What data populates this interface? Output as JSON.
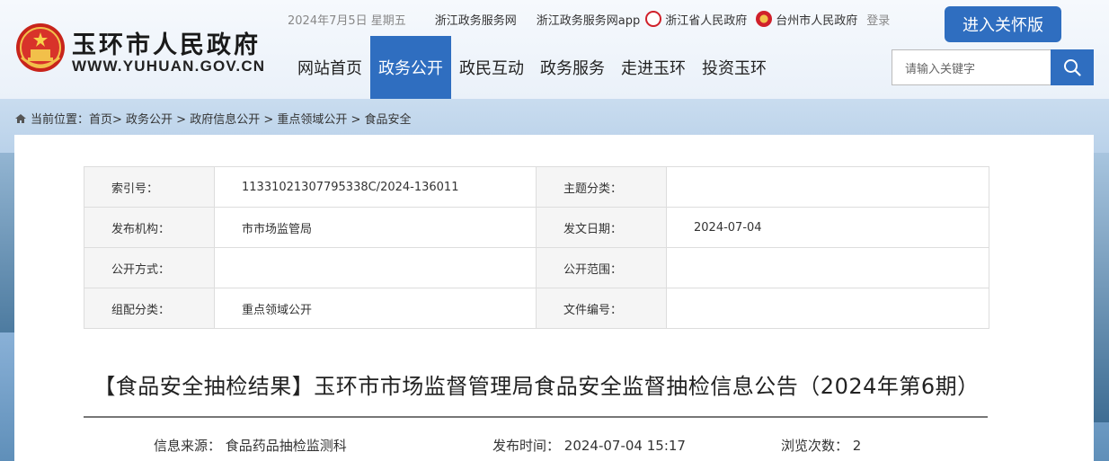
{
  "header": {
    "site_name": "玉环市人民政府",
    "site_url": "WWW.YUHUAN.GOV.CN",
    "date": "2024年7月5日 星期五",
    "links": [
      "浙江政务服务网",
      "浙江政务服务网app",
      "浙江省人民政府",
      "台州市人民政府"
    ],
    "login": "登录",
    "care_button": "进入关怀版",
    "search_placeholder": "请输入关键字"
  },
  "nav": {
    "items": [
      "网站首页",
      "政务公开",
      "政民互动",
      "政务服务",
      "走进玉环",
      "投资玉环"
    ],
    "active_index": 1
  },
  "breadcrumb": {
    "prefix": "当前位置：",
    "path": "首页> 政务公开 > 政府信息公开 > 重点领域公开 > 食品安全"
  },
  "meta": {
    "rows": [
      {
        "l1": "索引号：",
        "v1": "11331021307795338C/2024-136011",
        "l2": "主题分类：",
        "v2": ""
      },
      {
        "l1": "发布机构：",
        "v1": "市市场监管局",
        "l2": "发文日期：",
        "v2": "2024-07-04"
      },
      {
        "l1": "公开方式：",
        "v1": "",
        "l2": "公开范围：",
        "v2": ""
      },
      {
        "l1": "组配分类：",
        "v1": "重点领域公开",
        "l2": "文件编号：",
        "v2": ""
      }
    ]
  },
  "article": {
    "title": "【食品安全抽检结果】玉环市市场监督管理局食品安全监督抽检信息公告（2024年第6期）",
    "source_label": "信息来源：",
    "source": "食品药品抽检监测科",
    "time_label": "发布时间：",
    "time": "2024-07-04 15:17",
    "views_label": "浏览次数：",
    "views": "2"
  },
  "colors": {
    "accent": "#2f6ec0"
  }
}
